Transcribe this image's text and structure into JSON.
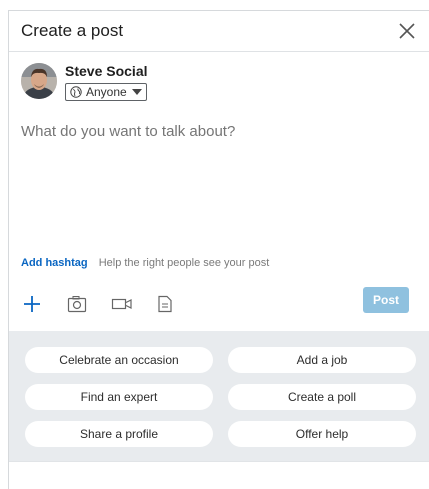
{
  "header": {
    "title": "Create a post"
  },
  "author": {
    "name": "Steve Social",
    "visibility": "Anyone"
  },
  "composer": {
    "placeholder": "What do you want to talk about?"
  },
  "hashtag": {
    "link": "Add hashtag",
    "help": "Help the right people see your post"
  },
  "toolbar": {
    "icons": [
      "plus-icon",
      "camera-icon",
      "video-icon",
      "document-icon"
    ],
    "post_label": "Post"
  },
  "actions": [
    "Celebrate an occasion",
    "Add a job",
    "Find an expert",
    "Create a poll",
    "Share a profile",
    "Offer help"
  ],
  "colors": {
    "accent": "#0a66c2",
    "post_disabled": "#8fc1df",
    "panel_bg": "#e8ebee"
  }
}
